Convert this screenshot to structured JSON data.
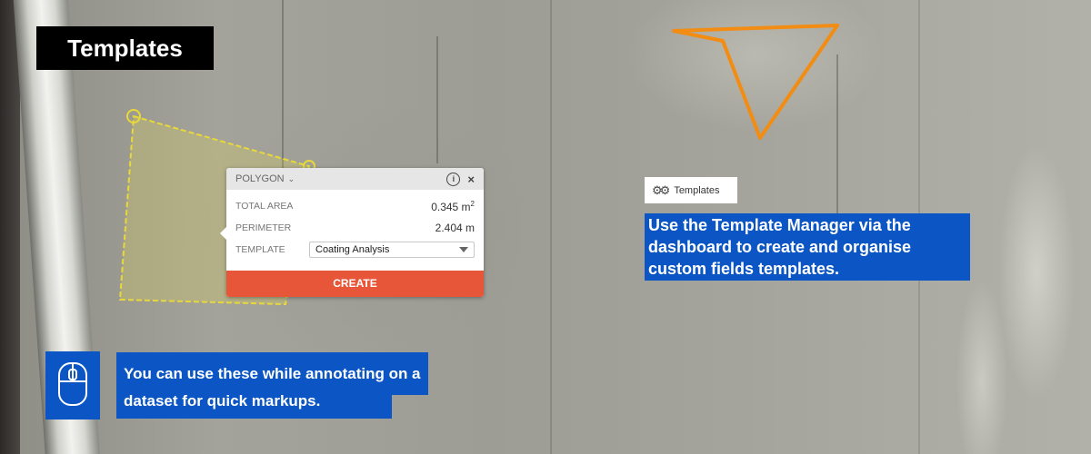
{
  "title": "Templates",
  "popup": {
    "type_label": "POLYGON",
    "rows": [
      {
        "label": "TOTAL AREA",
        "value": "0.345 m",
        "unit_sup": "2"
      },
      {
        "label": "PERIMETER",
        "value": "2.404 m",
        "unit_sup": ""
      }
    ],
    "template_label": "TEMPLATE",
    "template_selected": "Coating Analysis",
    "create_label": "CREATE",
    "icons": {
      "info": "info-icon",
      "close": "close-icon",
      "dropdown": "chevron-down-icon"
    }
  },
  "template_chip": {
    "icon": "gears-icon",
    "label": "Templates"
  },
  "callout_right": "Use the Template Manager via the dashboard to create and organise custom fields templates.",
  "callout_left": "You can use these while annotating on a dataset for quick markups.",
  "colors": {
    "accent_blue": "#0b56c4",
    "create_orange": "#e8563a",
    "annotation_orange": "#f28c13",
    "polygon_yellow": "#f2e24a"
  }
}
